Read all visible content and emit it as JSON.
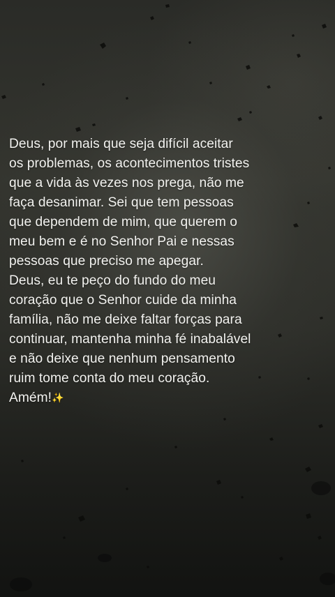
{
  "caption": {
    "lines": [
      "Deus, por mais que seja difícil aceitar",
      "os problemas, os acontecimentos tristes",
      "que a vida às vezes nos prega, não me",
      "faça desanimar. Sei que tem pessoas",
      "que dependem de mim, que querem o",
      "meu bem e é no Senhor Pai e nessas",
      "pessoas que preciso me apegar.",
      "Deus, eu te peço do fundo do meu",
      "coração que o Senhor cuide da minha",
      "família, não me deixe faltar forças para",
      "continuar, mantenha minha fé inabalável",
      "e não deixe que nenhum pensamento",
      "ruim tome conta do meu coração.",
      "Amém!"
    ],
    "emoji": "✨"
  },
  "colors": {
    "text": "#f2f2ef",
    "background": "#2d2e29",
    "sparkle": "#f4d35e"
  }
}
